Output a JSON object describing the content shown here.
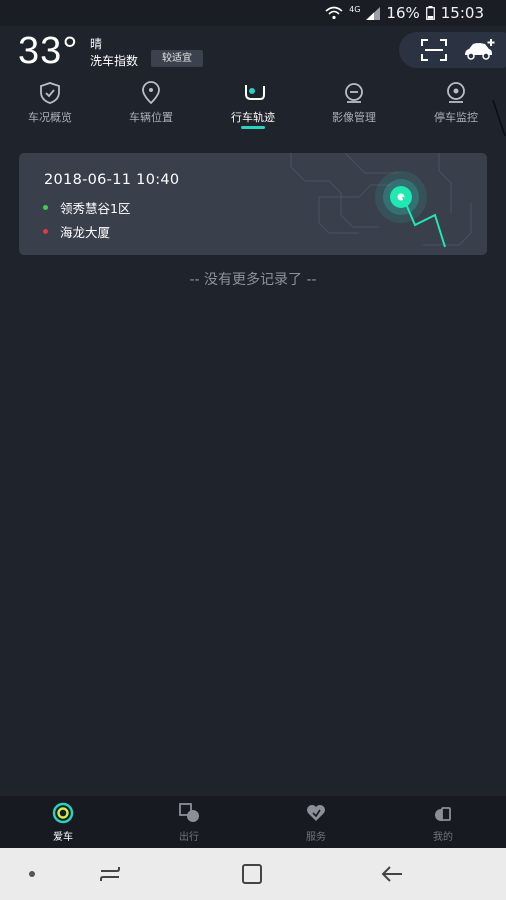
{
  "status_bar": {
    "network": "4G",
    "battery": "16%",
    "time": "15:03"
  },
  "header": {
    "temperature": "33°",
    "weather": "晴",
    "wash_index_label": "洗车指数",
    "wash_index_value": "较适宜"
  },
  "tabs": [
    {
      "label": "车况概览",
      "icon": "shield-check-icon",
      "active": false
    },
    {
      "label": "车辆位置",
      "icon": "location-pin-icon",
      "active": false
    },
    {
      "label": "行车轨迹",
      "icon": "track-icon",
      "active": true
    },
    {
      "label": "影像管理",
      "icon": "camera-lens-icon",
      "active": false
    },
    {
      "label": "停车监控",
      "icon": "monitor-eye-icon",
      "active": false
    }
  ],
  "trip": {
    "datetime": "2018-06-11 10:40",
    "start": "领秀慧谷1区",
    "end": "海龙大厦",
    "start_color": "#3ccf4e",
    "end_color": "#e23a3a"
  },
  "no_more_text": "-- 没有更多记录了 --",
  "bottom_nav": [
    {
      "label": "爱车",
      "icon": "car-ring-icon",
      "active": true
    },
    {
      "label": "出行",
      "icon": "travel-icon",
      "active": false
    },
    {
      "label": "服务",
      "icon": "heart-service-icon",
      "active": false
    },
    {
      "label": "我的",
      "icon": "profile-icon",
      "active": false
    }
  ],
  "colors": {
    "accent": "#2ad3c0",
    "background": "#1f232b",
    "card": "#3a3f4c"
  }
}
